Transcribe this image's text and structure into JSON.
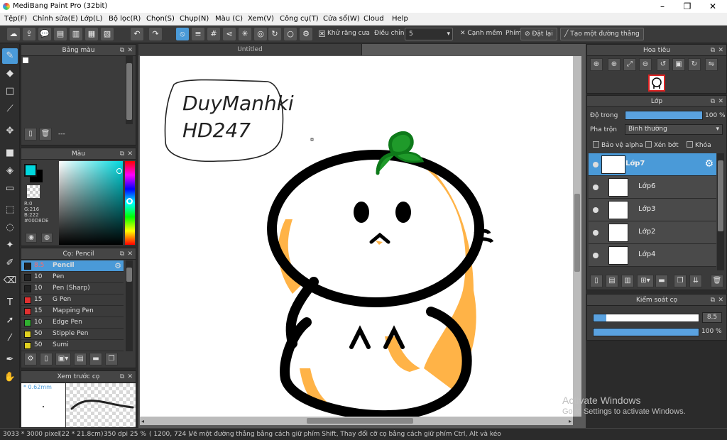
{
  "app": {
    "title": "MediBang Paint Pro (32bit)"
  },
  "menu": [
    "Tệp(F)",
    "Chỉnh sửa(E)",
    "Lớp(L)",
    "Bộ lọc(R)",
    "Chọn(S)",
    "Chụp(N)",
    "Màu (C)",
    "Xem(V)",
    "Công cụ(T)",
    "Cửa sổ(W)",
    "Cloud",
    "Help"
  ],
  "toolbar": {
    "antialias_label": "Khử răng cưa",
    "correction_label": "Điều chỉnh",
    "correction_value": "5",
    "soft_edge_label": "Cạnh mềm",
    "key_label": "Phím",
    "reset_label": "Đặt lại",
    "line_label": "Tạo một đường thẳng"
  },
  "palette": {
    "title": "Bảng màu",
    "status": "---"
  },
  "color": {
    "title": "Màu",
    "r": "R:0",
    "g": "G:216",
    "b": "B:222",
    "hex": "#00D8DE",
    "current": "#00D8DE"
  },
  "brush": {
    "title": "Cọ: Pencil",
    "items": [
      {
        "size": "8.5",
        "name": "Pencil",
        "color": "#222222"
      },
      {
        "size": "10",
        "name": "Pen",
        "color": "#222222"
      },
      {
        "size": "10",
        "name": "Pen (Sharp)",
        "color": "#222222"
      },
      {
        "size": "15",
        "name": "G Pen",
        "color": "#e03030"
      },
      {
        "size": "15",
        "name": "Mapping Pen",
        "color": "#e03030"
      },
      {
        "size": "10",
        "name": "Edge Pen",
        "color": "#30b030"
      },
      {
        "size": "50",
        "name": "Stipple Pen",
        "color": "#e0d020"
      },
      {
        "size": "50",
        "name": "Sumi",
        "color": "#e0d020"
      }
    ]
  },
  "preview": {
    "title": "Xem trước cọ",
    "size": "* 0.62mm"
  },
  "document": {
    "tab": "Untitled",
    "handwriting_line1": "DuyManhki",
    "handwriting_line2": "HD247"
  },
  "navigator": {
    "title": "Hoa tiêu"
  },
  "layer": {
    "title": "Lớp",
    "opacity_label": "Độ trong",
    "opacity_value": "100 %",
    "opacity": 1.0,
    "blend_label": "Pha trộn",
    "blend_value": "Bình thường",
    "protect_alpha": "Bảo vệ alpha",
    "clipping": "Xén bớt",
    "lock": "Khóa",
    "items": [
      "Lớp7",
      "Lớp6",
      "Lớp3",
      "Lớp2",
      "Lớp4"
    ]
  },
  "brush_control": {
    "title": "Kiểm soát cọ",
    "size_value": "8.5",
    "size_fraction": 0.12,
    "opacity_value": "100 %",
    "opacity": 1.0
  },
  "status": {
    "pixels": "3033 * 3000 pixel",
    "cm": "(22 * 21.8cm)",
    "dpi": "350 dpi",
    "zoom": "25 %",
    "coords": "( 1200, 724 )",
    "hint": "Vẽ một đường thẳng bằng cách giữ phím Shift, Thay đổi cỡ cọ bằng cách giữ phím Ctrl, Alt và kéo"
  },
  "watermark": {
    "line1": "Activate Windows",
    "line2": "Go to Settings to activate Windows."
  }
}
